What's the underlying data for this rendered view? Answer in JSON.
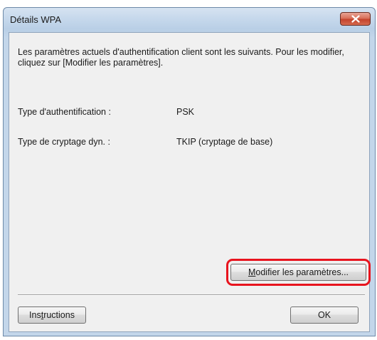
{
  "window": {
    "title": "Détails WPA",
    "close_icon": "close-icon"
  },
  "intro_text": "Les paramètres actuels d'authentification client sont les suivants. Pour les modifier, cliquez sur [Modifier les paramètres].",
  "fields": [
    {
      "label": "Type d'authentification :",
      "value": "PSK"
    },
    {
      "label": "Type de cryptage dyn. :",
      "value": "TKIP (cryptage de base)"
    }
  ],
  "buttons": {
    "modify": {
      "prefix": "",
      "mnemonic": "M",
      "rest": "odifier les paramètres..."
    },
    "instructions": {
      "prefix": "Ins",
      "mnemonic": "t",
      "rest": "ructions"
    },
    "ok": "OK"
  },
  "colors": {
    "highlight": "#e8141e",
    "close_button": "#c4432c"
  }
}
